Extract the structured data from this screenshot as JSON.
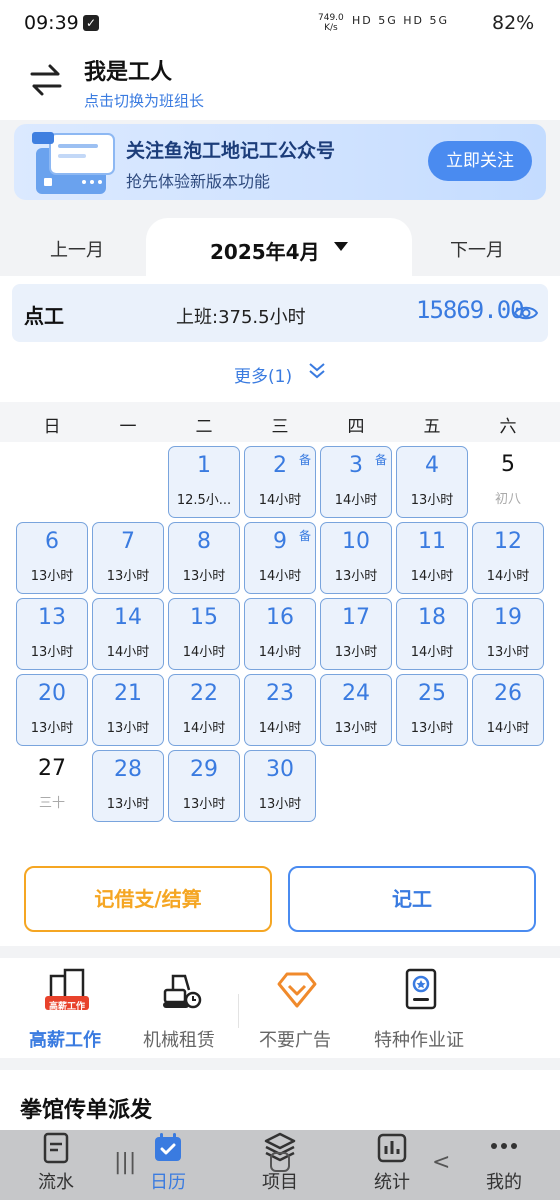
{
  "status": {
    "time": "09:39",
    "speed": "749.0\nK/s",
    "network": "HD 5G HD 5G",
    "battery": "82%"
  },
  "header": {
    "title": "我是工人",
    "subtitle": "点击切换为班组长"
  },
  "banner": {
    "title": "关注鱼泡工地记工公众号",
    "subtitle": "抢先体验新版本功能",
    "button": "立即关注"
  },
  "month": {
    "prev": "上一月",
    "current": "2025年4月",
    "next": "下一月"
  },
  "summary": {
    "type": "点工",
    "work": "上班:375.5小时",
    "amount": "15869.00"
  },
  "more": "更多(1)",
  "weekdays": [
    "日",
    "一",
    "二",
    "三",
    "四",
    "五",
    "六"
  ],
  "calendar": [
    {
      "day": "1",
      "text": "12.5小...",
      "filled": true
    },
    {
      "day": "2",
      "text": "14小时",
      "filled": true,
      "badge": "备"
    },
    {
      "day": "3",
      "text": "14小时",
      "filled": true,
      "badge": "备"
    },
    {
      "day": "4",
      "text": "13小时",
      "filled": true
    },
    {
      "day": "5",
      "text": "初八",
      "filled": false
    },
    {
      "day": "6",
      "text": "13小时",
      "filled": true
    },
    {
      "day": "7",
      "text": "13小时",
      "filled": true
    },
    {
      "day": "8",
      "text": "13小时",
      "filled": true
    },
    {
      "day": "9",
      "text": "14小时",
      "filled": true,
      "badge": "备"
    },
    {
      "day": "10",
      "text": "13小时",
      "filled": true
    },
    {
      "day": "11",
      "text": "14小时",
      "filled": true
    },
    {
      "day": "12",
      "text": "14小时",
      "filled": true
    },
    {
      "day": "13",
      "text": "13小时",
      "filled": true
    },
    {
      "day": "14",
      "text": "14小时",
      "filled": true
    },
    {
      "day": "15",
      "text": "14小时",
      "filled": true
    },
    {
      "day": "16",
      "text": "14小时",
      "filled": true
    },
    {
      "day": "17",
      "text": "13小时",
      "filled": true
    },
    {
      "day": "18",
      "text": "14小时",
      "filled": true
    },
    {
      "day": "19",
      "text": "13小时",
      "filled": true
    },
    {
      "day": "20",
      "text": "13小时",
      "filled": true
    },
    {
      "day": "21",
      "text": "13小时",
      "filled": true
    },
    {
      "day": "22",
      "text": "14小时",
      "filled": true
    },
    {
      "day": "23",
      "text": "14小时",
      "filled": true
    },
    {
      "day": "24",
      "text": "13小时",
      "filled": true
    },
    {
      "day": "25",
      "text": "13小时",
      "filled": true
    },
    {
      "day": "26",
      "text": "14小时",
      "filled": true
    },
    {
      "day": "27",
      "text": "三十",
      "filled": false
    },
    {
      "day": "28",
      "text": "13小时",
      "filled": true
    },
    {
      "day": "29",
      "text": "13小时",
      "filled": true
    },
    {
      "day": "30",
      "text": "13小时",
      "filled": true
    }
  ],
  "actions": {
    "settle": "记借支/结算",
    "record": "记工"
  },
  "services": [
    {
      "label": "高薪工作",
      "badge": "高薪工作",
      "icon": "building-icon"
    },
    {
      "label": "机械租赁",
      "icon": "excavator-icon"
    },
    {
      "label": "不要广告",
      "icon": "diamond-icon"
    },
    {
      "label": "特种作业证",
      "icon": "certificate-icon"
    }
  ],
  "job_title": "拳馆传单派发",
  "nav": [
    {
      "label": "流水",
      "icon": "ledger-icon"
    },
    {
      "label": "日历",
      "icon": "calendar-icon"
    },
    {
      "label": "项目",
      "icon": "layers-icon"
    },
    {
      "label": "统计",
      "icon": "chart-icon"
    },
    {
      "label": "我的",
      "icon": "more-icon"
    }
  ],
  "colors": {
    "accent": "#3a7be0",
    "warning": "#f5a623",
    "cell_bg": "#ebf2fc",
    "cell_border": "#79a4dd"
  }
}
